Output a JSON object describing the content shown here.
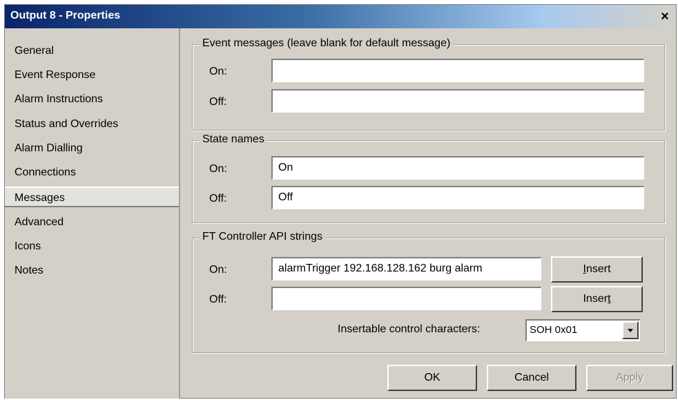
{
  "window": {
    "title": "Output 8 - Properties",
    "close_glyph": "×"
  },
  "sidebar": {
    "items": [
      {
        "label": "General"
      },
      {
        "label": "Event Response"
      },
      {
        "label": "Alarm Instructions"
      },
      {
        "label": "Status and Overrides"
      },
      {
        "label": "Alarm Dialling"
      },
      {
        "label": "Connections"
      },
      {
        "label": "Messages",
        "selected": true
      },
      {
        "label": "Advanced"
      },
      {
        "label": "Icons"
      },
      {
        "label": "Notes"
      }
    ]
  },
  "event_messages": {
    "title": "Event messages (leave blank for default message)",
    "on_label": "On:",
    "on_value": "",
    "off_label": "Off:",
    "off_value": ""
  },
  "state_names": {
    "title": "State names",
    "on_label": "On:",
    "on_value": "On",
    "off_label": "Off:",
    "off_value": "Off"
  },
  "api_strings": {
    "title": "FT Controller API strings",
    "on_label": "On:",
    "on_value": "alarmTrigger 192.168.128.162 burg alarm",
    "off_label": "Off:",
    "off_value": "",
    "insert_on_pre": "",
    "insert_on_u": "I",
    "insert_on_post": "nsert",
    "insert_off_pre": "Inser",
    "insert_off_u": "t",
    "insert_off_post": "",
    "control_chars_label": "Insertable control characters:",
    "control_chars_value": "SOH 0x01"
  },
  "footer": {
    "ok_label": "OK",
    "cancel_label": "Cancel",
    "apply_label": "Apply"
  }
}
